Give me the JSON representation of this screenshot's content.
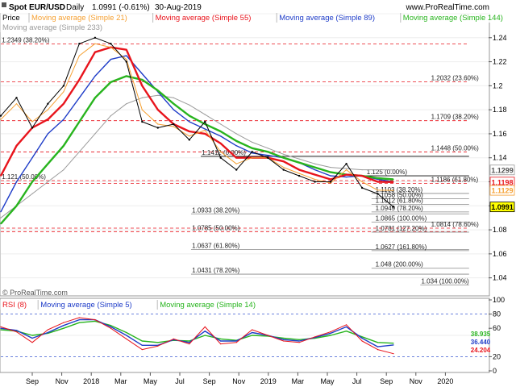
{
  "header": {
    "instrument": "Spot EUR/USD",
    "period": "Daily",
    "last": "1.0991 (-0.61%)",
    "date": "30-Aug-2019",
    "source": "www.ProRealTime.com",
    "watermark": "© ProRealTime.com"
  },
  "price_legend": [
    {
      "label": "Price",
      "color": "#000000"
    },
    {
      "label": "Moving average (Simple 21)",
      "color": "#f5a032"
    },
    {
      "label": "Moving average (Simple 55)",
      "color": "#e8141c"
    },
    {
      "label": "Moving average (Simple 89)",
      "color": "#1e3cc8"
    },
    {
      "label": "Moving average (Simple 144)",
      "color": "#28b41e"
    },
    {
      "label": "Moving average (Simple 233)",
      "color": "#9a9a9a"
    }
  ],
  "rsi_legend": [
    {
      "label": "RSI (8)",
      "color": "#e8141c"
    },
    {
      "label": "Moving average (Simple 5)",
      "color": "#1e3cc8"
    },
    {
      "label": "Moving average (Simple 14)",
      "color": "#28b41e"
    }
  ],
  "price_axis": {
    "min": 1.025,
    "max": 1.26,
    "ticks": [
      "1.24",
      "1.22",
      "1.2",
      "1.18",
      "1.16",
      "1.14",
      "1.12",
      "1.1",
      "1.08",
      "1.06",
      "1.04"
    ]
  },
  "rsi_axis": {
    "min": 0,
    "max": 100,
    "ticks": [
      "100",
      "80",
      "60",
      "20",
      "0"
    ]
  },
  "x_axis": {
    "ticks": [
      "Sep",
      "Nov",
      "2018",
      "Mar",
      "May",
      "Jul",
      "Sep",
      "Nov",
      "2019",
      "Mar",
      "May",
      "Jul",
      "Sep",
      "Nov",
      "2020"
    ]
  },
  "price_tags": [
    {
      "label": "1.1299",
      "value": 1.1299,
      "bg": "#ffffff",
      "fg": "#555555",
      "border": "#999999"
    },
    {
      "label": "1.1198",
      "value": 1.1198,
      "bg": "#ffffff",
      "fg": "#e8141c",
      "border": "#e8141c"
    },
    {
      "label": "1.1129",
      "value": 1.1129,
      "bg": "#ffffff",
      "fg": "#f5a032",
      "border": "#f5a032"
    },
    {
      "label": "1.0991",
      "value": 1.0991,
      "bg": "#ffff00",
      "fg": "#000000",
      "border": "#000000"
    }
  ],
  "rsi_tags": [
    {
      "label": "38.935",
      "value": 38.935,
      "fg": "#28b41e"
    },
    {
      "label": "36.440",
      "value": 36.44,
      "fg": "#1e3cc8"
    },
    {
      "label": "24.204",
      "value": 24.204,
      "fg": "#e8141c"
    }
  ],
  "fib_levels": [
    {
      "value": 1.2349,
      "label": "1.2349 (38.20%)",
      "xs": 0.0,
      "xe": 0.96,
      "lx": 0.002,
      "color": "#e8141c",
      "dash": true
    },
    {
      "value": 1.2032,
      "label": "1.2032 (23.60%)",
      "xs": 0.0,
      "xe": 0.96,
      "lx": 0.882,
      "color": "#e8141c",
      "dash": true
    },
    {
      "value": 1.1709,
      "label": "1.1709 (38.20%)",
      "xs": 0.0,
      "xe": 0.96,
      "lx": 0.882,
      "color": "#e8141c",
      "dash": true
    },
    {
      "value": 1.1448,
      "label": "1.1448 (50.00%)",
      "xs": 0.0,
      "xe": 0.96,
      "lx": 0.882,
      "color": "#e8141c",
      "dash": true
    },
    {
      "value": 1.1412,
      "label": "1.1412 (0.00%)",
      "xs": 0.41,
      "xe": 0.96,
      "lx": 0.412,
      "color": "#000000",
      "dash": false
    },
    {
      "value": 1.125,
      "label": "1.125 (0.00%)",
      "xs": 0.748,
      "xe": 0.96,
      "lx": 0.75,
      "color": "#000000",
      "dash": false
    },
    {
      "value": 1.121,
      "label": "1.121 (50.00%)",
      "xs": 0.0,
      "xe": 0.96,
      "lx": 0.002,
      "color": "#e8141c",
      "dash": true
    },
    {
      "value": 1.1186,
      "label": "1.1186 (61.80%)",
      "xs": 0.0,
      "xe": 0.96,
      "lx": 0.882,
      "color": "#e8141c",
      "dash": true
    },
    {
      "value": 1.1103,
      "label": "1.1103 (38.20%)",
      "xs": 0.76,
      "xe": 0.96,
      "lx": 0.768,
      "color": "#888888",
      "dash": false
    },
    {
      "value": 1.1058,
      "label": "1.1058 (50.00%)",
      "xs": 0.76,
      "xe": 0.96,
      "lx": 0.768,
      "color": "#888888",
      "dash": false
    },
    {
      "value": 1.1012,
      "label": "1.1012 (61.80%)",
      "xs": 0.76,
      "xe": 0.96,
      "lx": 0.768,
      "color": "#888888",
      "dash": false
    },
    {
      "value": 1.0949,
      "label": "1.0949 (78.20%)",
      "xs": 0.76,
      "xe": 0.96,
      "lx": 0.768,
      "color": "#888888",
      "dash": false
    },
    {
      "value": 1.0933,
      "label": "1.0933 (38.20%)",
      "xs": 0.39,
      "xe": 0.96,
      "lx": 0.392,
      "color": "#888888",
      "dash": false
    },
    {
      "value": 1.0865,
      "label": "1.0865 (100.00%)",
      "xs": 0.76,
      "xe": 0.96,
      "lx": 0.768,
      "color": "#888888",
      "dash": false
    },
    {
      "value": 1.0814,
      "label": "1.0814 (78.60%)",
      "xs": 0.0,
      "xe": 0.96,
      "lx": 0.882,
      "color": "#e8141c",
      "dash": true
    },
    {
      "value": 1.0785,
      "label": "1.0785 (50.00%)",
      "xs": 0.0,
      "xe": 0.96,
      "lx": 0.392,
      "color": "#e8141c",
      "dash": true
    },
    {
      "value": 1.0781,
      "label": "1.0781 (127.20%)",
      "xs": 0.76,
      "xe": 0.96,
      "lx": 0.768,
      "color": "#888888",
      "dash": false
    },
    {
      "value": 1.0637,
      "label": "1.0637 (61.80%)",
      "xs": 0.39,
      "xe": 0.96,
      "lx": 0.392,
      "color": "#888888",
      "dash": false
    },
    {
      "value": 1.0627,
      "label": "1.0627 (161.80%)",
      "xs": 0.76,
      "xe": 0.96,
      "lx": 0.768,
      "color": "#888888",
      "dash": false
    },
    {
      "value": 1.048,
      "label": "1.048 (200.00%)",
      "xs": 0.76,
      "xe": 0.96,
      "lx": 0.768,
      "color": "#888888",
      "dash": false
    },
    {
      "value": 1.0431,
      "label": "1.0431 (78.20%)",
      "xs": 0.39,
      "xe": 0.96,
      "lx": 0.392,
      "color": "#888888",
      "dash": false
    },
    {
      "value": 1.034,
      "label": "1.034 (100.00%)",
      "xs": 0.86,
      "xe": 0.96,
      "lx": 0.862,
      "color": "#888888",
      "dash": false
    }
  ],
  "chart_data": {
    "type": "line",
    "title": "Spot EUR/USD Daily",
    "x": [
      "2017-08",
      "2017-09",
      "2017-10",
      "2017-11",
      "2017-12",
      "2018-01",
      "2018-02",
      "2018-03",
      "2018-04",
      "2018-05",
      "2018-06",
      "2018-07",
      "2018-08",
      "2018-09",
      "2018-10",
      "2018-11",
      "2018-12",
      "2019-01",
      "2019-02",
      "2019-03",
      "2019-04",
      "2019-05",
      "2019-06",
      "2019-07",
      "2019-08",
      "2019-08-30"
    ],
    "ylim": [
      1.025,
      1.26
    ],
    "series": [
      {
        "name": "Price",
        "color": "#000000",
        "values": [
          1.175,
          1.19,
          1.165,
          1.185,
          1.2,
          1.235,
          1.24,
          1.235,
          1.22,
          1.17,
          1.165,
          1.168,
          1.155,
          1.17,
          1.14,
          1.13,
          1.145,
          1.14,
          1.13,
          1.125,
          1.12,
          1.12,
          1.135,
          1.115,
          1.11,
          1.0991
        ]
      },
      {
        "name": "Moving average (Simple 21)",
        "color": "#f5a032",
        "values": [
          1.172,
          1.185,
          1.17,
          1.18,
          1.195,
          1.225,
          1.235,
          1.232,
          1.222,
          1.18,
          1.168,
          1.166,
          1.158,
          1.163,
          1.145,
          1.135,
          1.14,
          1.14,
          1.132,
          1.127,
          1.122,
          1.119,
          1.13,
          1.12,
          1.113,
          1.1129
        ]
      },
      {
        "name": "Moving average (Simple 55)",
        "color": "#e8141c",
        "values": [
          1.125,
          1.15,
          1.165,
          1.172,
          1.185,
          1.205,
          1.228,
          1.232,
          1.23,
          1.2,
          1.18,
          1.168,
          1.162,
          1.16,
          1.152,
          1.14,
          1.14,
          1.14,
          1.137,
          1.13,
          1.126,
          1.122,
          1.126,
          1.125,
          1.12,
          1.1198
        ]
      },
      {
        "name": "Moving average (Simple 89)",
        "color": "#1e3cc8",
        "values": [
          1.095,
          1.12,
          1.14,
          1.16,
          1.172,
          1.19,
          1.208,
          1.222,
          1.225,
          1.21,
          1.195,
          1.18,
          1.17,
          1.164,
          1.158,
          1.15,
          1.144,
          1.142,
          1.14,
          1.136,
          1.13,
          1.125,
          1.124,
          1.125,
          1.122,
          1.12
        ]
      },
      {
        "name": "Moving average (Simple 144)",
        "color": "#28b41e",
        "values": [
          1.085,
          1.1,
          1.12,
          1.135,
          1.15,
          1.17,
          1.19,
          1.203,
          1.208,
          1.205,
          1.196,
          1.185,
          1.175,
          1.168,
          1.162,
          1.154,
          1.148,
          1.145,
          1.14,
          1.136,
          1.132,
          1.128,
          1.126,
          1.125,
          1.123,
          1.122
        ]
      },
      {
        "name": "Moving average (Simple 233)",
        "color": "#9a9a9a",
        "values": [
          1.09,
          1.1,
          1.11,
          1.12,
          1.13,
          1.145,
          1.16,
          1.175,
          1.185,
          1.19,
          1.192,
          1.19,
          1.184,
          1.176,
          1.168,
          1.16,
          1.153,
          1.148,
          1.143,
          1.139,
          1.135,
          1.132,
          1.131,
          1.13,
          1.13,
          1.1299
        ]
      }
    ],
    "rsi": {
      "ylim": [
        0,
        100
      ],
      "series": [
        {
          "name": "RSI (8)",
          "color": "#e8141c",
          "values": [
            62,
            55,
            40,
            58,
            68,
            75,
            72,
            60,
            45,
            30,
            35,
            45,
            38,
            62,
            38,
            40,
            58,
            50,
            42,
            40,
            48,
            55,
            65,
            42,
            30,
            24.204
          ]
        },
        {
          "name": "Moving average (Simple 5)",
          "color": "#1e3cc8",
          "values": [
            60,
            57,
            46,
            54,
            64,
            72,
            72,
            62,
            50,
            36,
            36,
            44,
            40,
            56,
            42,
            42,
            54,
            50,
            44,
            42,
            47,
            53,
            62,
            46,
            34,
            36.44
          ]
        },
        {
          "name": "Moving average (Simple 14)",
          "color": "#28b41e",
          "values": [
            58,
            56,
            50,
            53,
            60,
            68,
            70,
            64,
            54,
            42,
            40,
            43,
            42,
            50,
            45,
            43,
            50,
            49,
            46,
            44,
            46,
            50,
            56,
            48,
            40,
            38.935
          ]
        }
      ]
    }
  }
}
